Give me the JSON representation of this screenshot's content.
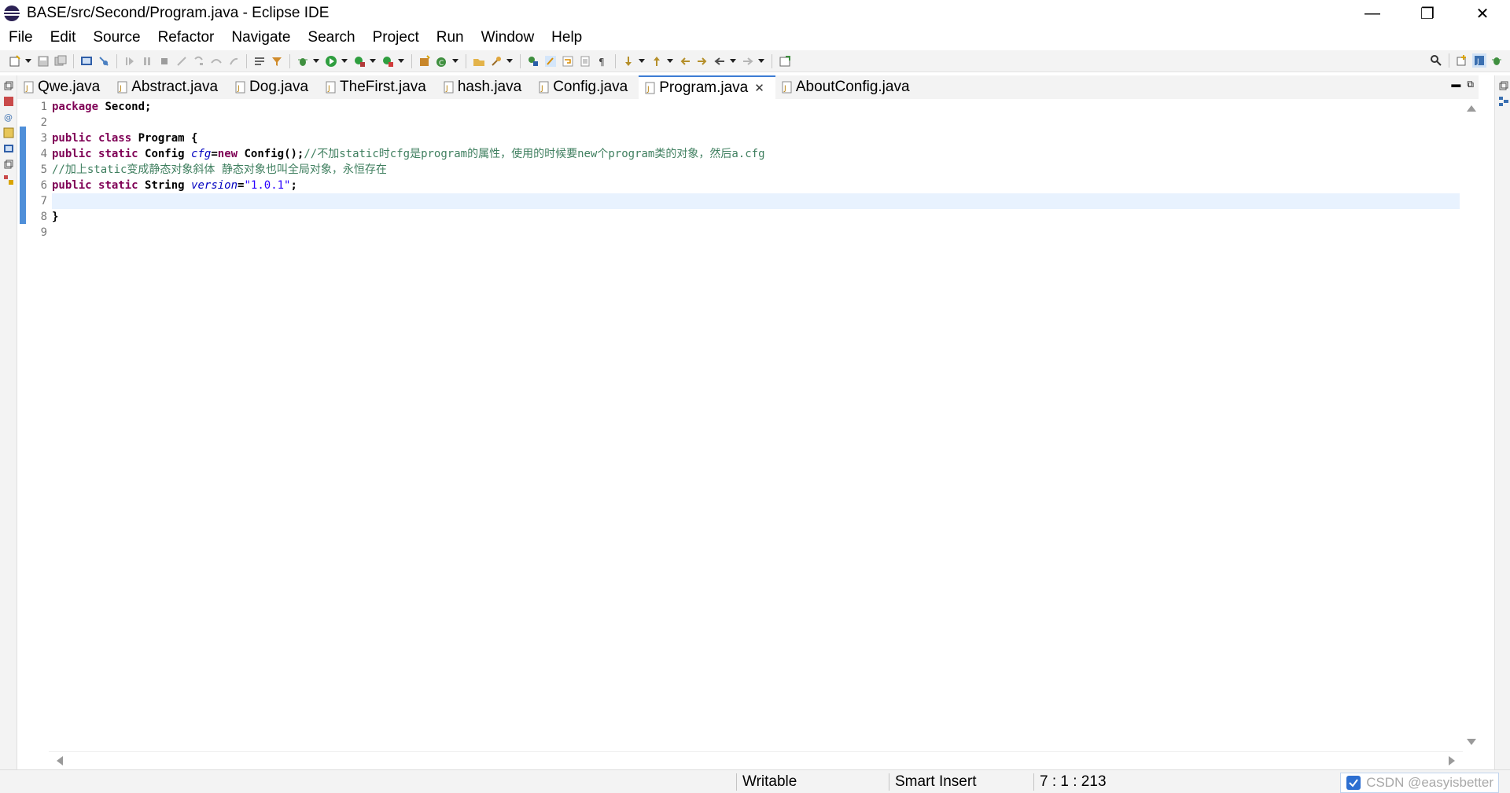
{
  "window": {
    "title": "BASE/src/Second/Program.java - Eclipse IDE",
    "minimize_glyph": "—",
    "restore_glyph": "❐",
    "close_glyph": "✕"
  },
  "menu": {
    "items": [
      "File",
      "Edit",
      "Source",
      "Refactor",
      "Navigate",
      "Search",
      "Project",
      "Run",
      "Window",
      "Help"
    ]
  },
  "tabs": {
    "items": [
      {
        "label": "Qwe.java",
        "active": false
      },
      {
        "label": "Abstract.java",
        "active": false
      },
      {
        "label": "Dog.java",
        "active": false
      },
      {
        "label": "TheFirst.java",
        "active": false
      },
      {
        "label": "hash.java",
        "active": false
      },
      {
        "label": "Config.java",
        "active": false
      },
      {
        "label": "Program.java",
        "active": true
      },
      {
        "label": "AboutConfig.java",
        "active": false
      }
    ],
    "close_glyph": "✕",
    "minimize_glyph": "▬",
    "maximize_glyph": "⧉"
  },
  "editor": {
    "line_numbers": [
      "1",
      "2",
      "3",
      "4",
      "5",
      "6",
      "7",
      "8",
      "9"
    ],
    "current_line": 7,
    "lines": {
      "l1_kw": "package",
      "l1_rest": " Second;",
      "l3_kw1": "public",
      "l3_kw2": "class",
      "l3_rest": " Program {",
      "l4_kw1": "public",
      "l4_kw2": "static",
      "l4_type": " Config ",
      "l4_field": "cfg",
      "l4_eq": "=",
      "l4_kw3": "new",
      "l4_call": " Config();",
      "l4_comment": "//不加static时cfg是program的属性，使用的时候要new个program类的对象，然后a.cfg",
      "l5_comment": "//加上static变成静态对象斜体 静态对象也叫全局对象，永恒存在",
      "l6_kw1": "public",
      "l6_kw2": "static",
      "l6_type": " String ",
      "l6_field": "version",
      "l6_eq": "=",
      "l6_str": "\"1.0.1\"",
      "l6_end": ";",
      "l8": "}"
    }
  },
  "status": {
    "writable": "Writable",
    "insert_mode": "Smart Insert",
    "position": "7 : 1 : 213",
    "watermark": "CSDN @easyisbetter"
  },
  "colors": {
    "keyword": "#7f0055",
    "comment": "#3f7f5f",
    "string": "#2a00ff",
    "field": "#0000c0",
    "active_tab_accent": "#3c7cd4",
    "current_line": "#e8f2fe"
  },
  "icons": {
    "app": "eclipse-logo-icon",
    "java_file": "java-file-icon",
    "search": "search-icon",
    "perspective": "open-perspective-icon",
    "java_perspective": "java-perspective-icon",
    "debug_perspective": "debug-perspective-icon"
  }
}
